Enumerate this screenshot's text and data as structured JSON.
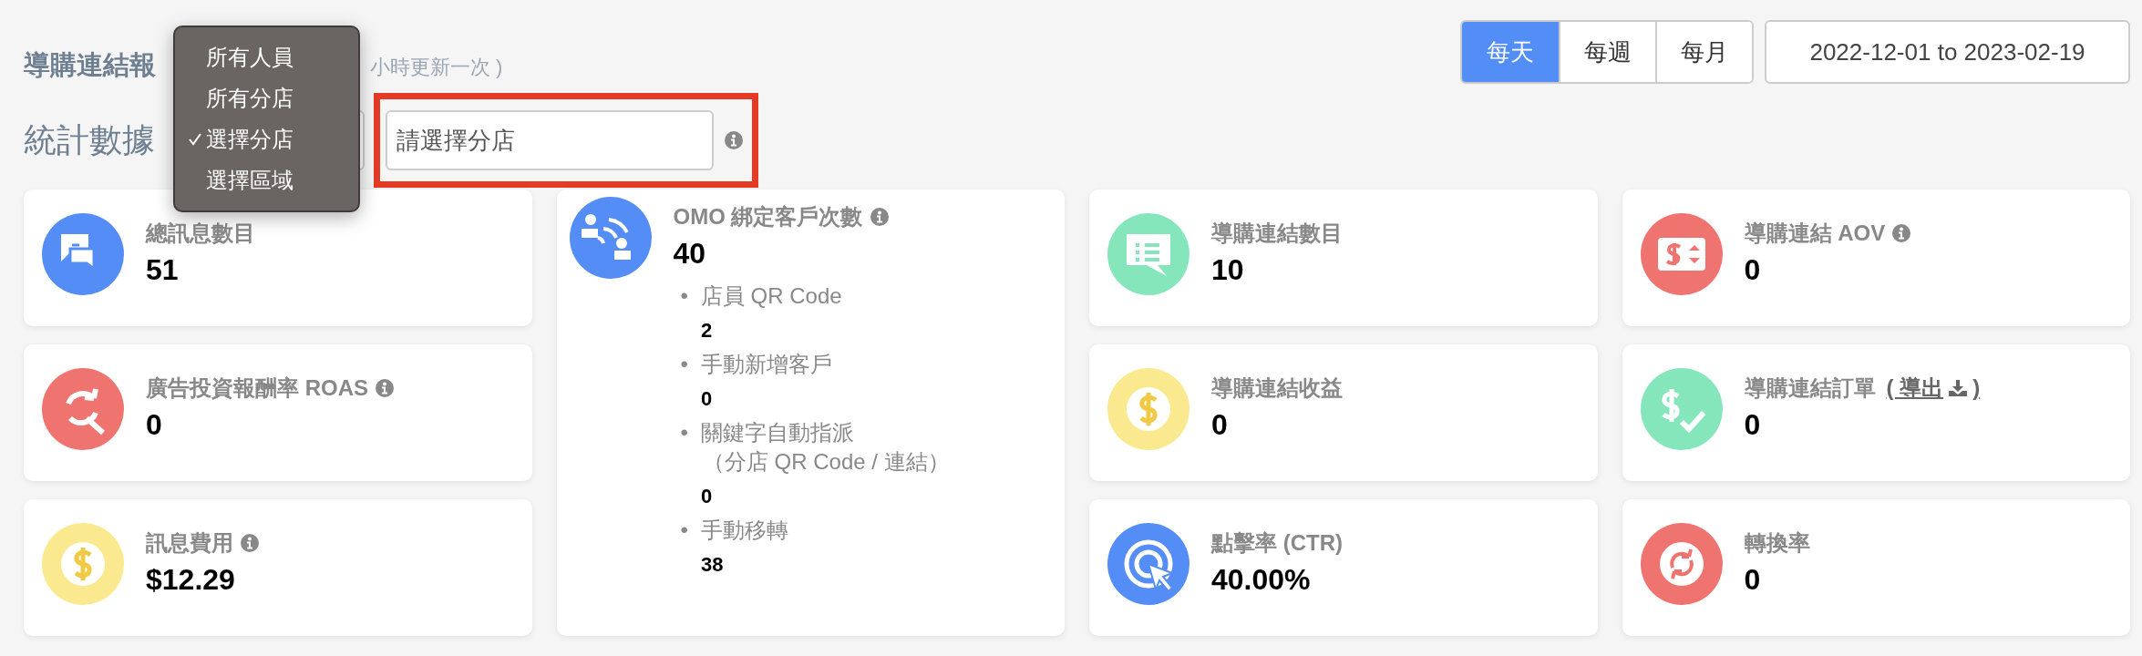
{
  "header": {
    "title": "導購連結報",
    "subtitle": "小時更新一次 )"
  },
  "period_tabs": [
    {
      "label": "每天",
      "selected": true
    },
    {
      "label": "每週",
      "selected": false
    },
    {
      "label": "每月",
      "selected": false
    }
  ],
  "date_range": {
    "value": "2022-12-01 to 2023-02-19"
  },
  "filter": {
    "label": "統計數據",
    "scope_menu": [
      {
        "label": "所有人員",
        "selected": false
      },
      {
        "label": "所有分店",
        "selected": false
      },
      {
        "label": "選擇分店",
        "selected": true
      },
      {
        "label": "選擇區域",
        "selected": false
      }
    ],
    "branch_field": {
      "placeholder": "請選擇分店",
      "highlighted": true
    }
  },
  "columns": [
    [
      {
        "title": "總訊息數目",
        "info": false,
        "value": "51",
        "color": "#558df6"
      },
      {
        "title": "廣告投資報酬率 ROAS",
        "info": true,
        "value": "0",
        "color": "#ef7470"
      },
      {
        "title": "訊息費用",
        "info": true,
        "value": "$12.29",
        "color": "#fbe98f"
      }
    ],
    [
      {
        "title": "OMO 綁定客戶次數",
        "info": true,
        "value": "40",
        "color": "#558df6",
        "breakdown": [
          {
            "bullet": "•",
            "label": "店員 QR Code",
            "value": "2"
          },
          {
            "bullet": "•",
            "label": "手動新增客戶",
            "value": "0"
          },
          {
            "bullet": "•",
            "label": "關鍵字自動指派",
            "label_2": "（分店 QR Code / 連結）",
            "value": "0"
          },
          {
            "bullet": "•",
            "label": "手動移轉",
            "value": "38"
          }
        ]
      }
    ],
    [
      {
        "title": "導購連結數目",
        "info": false,
        "value": "10",
        "color": "#86e6bb"
      },
      {
        "title": "導購連結收益",
        "info": false,
        "value": "0",
        "color": "#fbe98f"
      },
      {
        "title": "點擊率 (CTR)",
        "info": false,
        "value": "40.00%",
        "color": "#558df6"
      }
    ],
    [
      {
        "title": "導購連結 AOV",
        "info": true,
        "value": "0",
        "color": "#ef7470"
      },
      {
        "title": "導購連結訂單",
        "info": false,
        "value": "0",
        "color": "#86e6bb",
        "link": {
          "before": "( 導出",
          "after": ")"
        }
      },
      {
        "title": "轉換率",
        "info": false,
        "value": "0",
        "color": "#ef7470"
      }
    ]
  ]
}
